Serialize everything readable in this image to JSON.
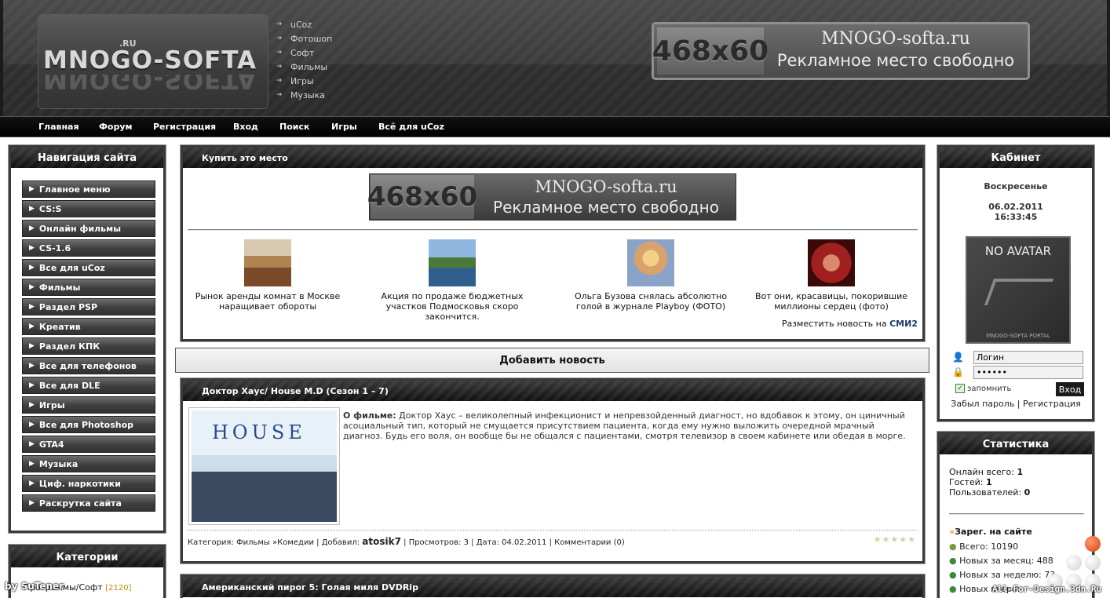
{
  "header": {
    "logo_text": "MNOGO-SOFTA",
    "logo_suffix": ".RU",
    "top_links": [
      "uCoz",
      "Фотошоп",
      "Софт",
      "Фильмы",
      "Игры",
      "Музыка"
    ],
    "banner": {
      "size": "468x60",
      "site": "MNOGO-softa.ru",
      "text": "Рекламное место свободно"
    }
  },
  "nav": [
    "Главная",
    "Форум",
    "Регистрация",
    "Вход",
    "Поиск",
    "Игры",
    "Всё для uCoz"
  ],
  "left_nav": {
    "title": "Навигация сайта",
    "items": [
      "Главное меню",
      "CS:S",
      "Онлайн фильмы",
      "CS-1.6",
      "Все для uCoz",
      "Фильмы",
      "Раздел PSP",
      "Креатив",
      "Раздел КПК",
      "Все для телефонов",
      "Все для DLE",
      "Игры",
      "Все для Photoshop",
      "GTA4",
      "Музыка",
      "Циф. наркотики",
      "Раскрутка сайта"
    ]
  },
  "categories": {
    "title": "Категории",
    "first_item": "Программы/Софт",
    "first_count": "[2120]"
  },
  "ad_block": {
    "title": "Купить это место",
    "banner": {
      "size": "468x60",
      "site": "MNOGO-softa.ru",
      "text": "Рекламное место свободно"
    },
    "news": [
      "Рынок аренды комнат в Москве наращивает обороты",
      "Акция по продаже бюджетных участков Подмосковья скоро закончится.",
      "Ольга Бузова снялась абсолютно голой в журнале Playboy (ФОТО)",
      "Вот они, красавицы, покорившие миллионы сердец (фото)"
    ],
    "smi_text": "Разместить новость на",
    "smi_logo": "СМИ2"
  },
  "add_news": "Добавить новость",
  "post1": {
    "title": "Доктор Хаус/ House M.D (Сезон 1 – 7)",
    "image_title": "HOUSE",
    "about_label": "О фильме:",
    "about_text": "Доктор Хаус – великолепный инфекционист и непревзойденный диагност, но вдобавок к этому, он циничный асоциальный тип, который не смущается присутствием пациента, когда ему нужно выложить очередной мрачный диагноз. Будь его воля, он вообще бы не общался с пациентами, смотря телевизор в своем кабинете или обедая в морге.",
    "meta": {
      "category_label": "Категория:",
      "category": "Фильмы",
      "subcategory": "Комедии",
      "added_label": "Добавил:",
      "author": "atosik7",
      "views_label": "Просмотров:",
      "views": "3",
      "date_label": "Дата:",
      "date": "04.02.2011",
      "comments_label": "Комментарии",
      "comments": "(0)"
    }
  },
  "post2": {
    "title": "Американский пирог 5: Голая миля DVDRip"
  },
  "cabinet": {
    "title": "Кабинет",
    "day": "Воскресенье",
    "date": "06.02.2011",
    "time": "16:33:45",
    "avatar_text": "NO AVATAR",
    "avatar_caption": "MNOGO-SOFTA PORTAL",
    "login_value": "Логин",
    "password_value": "••••••",
    "remember": "запомнить",
    "login_button": "Вход",
    "forgot": "Забыл пароль",
    "register": "Регистрация"
  },
  "stats": {
    "title": "Статистика",
    "online_label": "Онлайн всего:",
    "online": "1",
    "guests_label": "Гостей:",
    "guests": "1",
    "users_label": "Пользователей:",
    "users": "0",
    "registered_title": "Зарег. на сайте",
    "total_label": "Всего:",
    "total": "10190",
    "month_label": "Новых за месяц:",
    "month": "488",
    "week_label": "Новых за неделю:",
    "week": "73",
    "yesterday_label": "Новых вчера:"
  },
  "watermark_left": "by SuTener",
  "watermark_right": "All-For-Design.3dn.Ru"
}
